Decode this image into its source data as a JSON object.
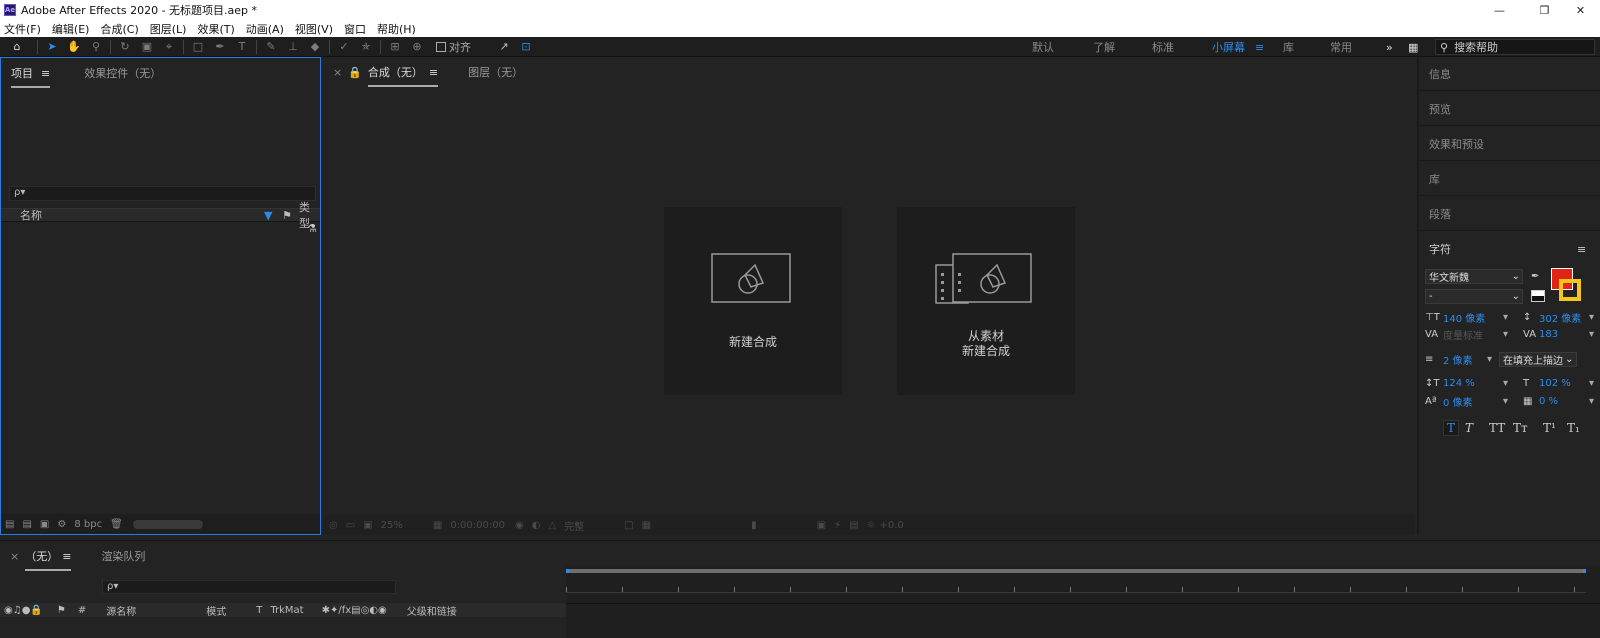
{
  "window": {
    "title": "Adobe After Effects 2020 - 无标题项目.aep *",
    "icon_text": "Ae"
  },
  "menu": [
    "文件(F)",
    "编辑(E)",
    "合成(C)",
    "图层(L)",
    "效果(T)",
    "动画(A)",
    "视图(V)",
    "窗口",
    "帮助(H)"
  ],
  "toolbar": {
    "align_label": "对齐"
  },
  "workspaces": [
    "默认",
    "了解",
    "标准",
    "小屏幕",
    "库",
    "常用"
  ],
  "active_workspace": "小屏幕",
  "help_search_placeholder": "搜索帮助",
  "project_panel": {
    "tabs": [
      "项目",
      "效果控件（无）"
    ],
    "search_placeholder": "ρ▾",
    "columns": {
      "name": "名称",
      "type": "类型"
    },
    "bpc": "8 bpc"
  },
  "comp_panel": {
    "tabs": [
      "合成（无）",
      "图层（无）"
    ],
    "new_comp": "新建合成",
    "from_footage_line1": "从素材",
    "from_footage_line2": "新建合成",
    "zoom": "25%",
    "timecode": "0:00:00:00",
    "resolution": "完整",
    "exposure": "+0.0"
  },
  "right_panel": {
    "sections": [
      "信息",
      "预览",
      "效果和预设",
      "库",
      "段落",
      "字符"
    ],
    "character": {
      "font": "华文新魏",
      "style": "-",
      "font_size": "140 像素",
      "leading": "302 像素",
      "kerning": "度量标准",
      "tracking": "183",
      "stroke_width": "2 像素",
      "stroke_mode": "在填充上描边",
      "vscale": "124 %",
      "hscale": "102 %",
      "baseline": "0 像素",
      "tsume": "0 %",
      "fill_color": "#e02514",
      "stroke_color": "#f5c518",
      "style_buttons": [
        "T",
        "T",
        "TT",
        "Tт",
        "T¹",
        "T₁"
      ]
    }
  },
  "timeline": {
    "tabs": [
      "（无）",
      "渲染队列"
    ],
    "search_placeholder": "ρ▾",
    "columns": [
      "源名称",
      "模式",
      "T",
      "TrkMat",
      "父级和链接"
    ]
  }
}
